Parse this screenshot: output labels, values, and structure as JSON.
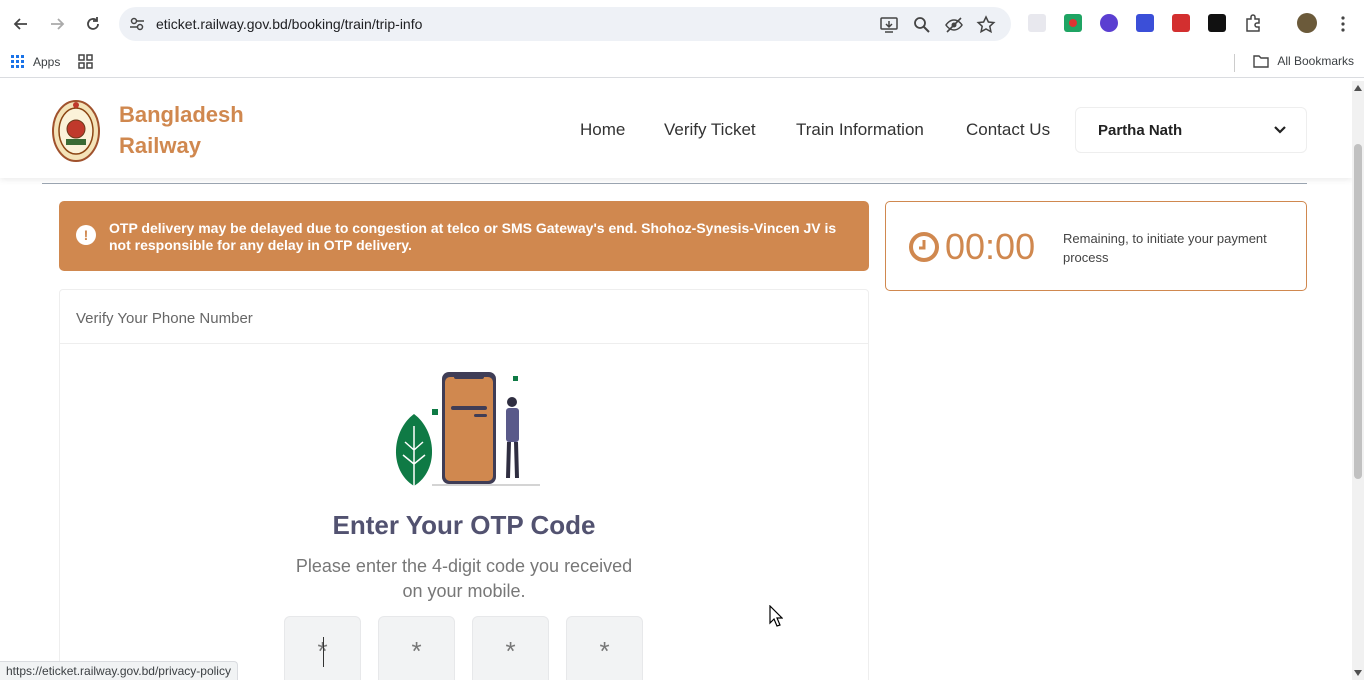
{
  "browser": {
    "url": "eticket.railway.gov.bd/booking/train/trip-info",
    "bookmarks": {
      "apps_label": "Apps",
      "all_bookmarks_label": "All Bookmarks"
    },
    "status_url": "https://eticket.railway.gov.bd/privacy-policy"
  },
  "header": {
    "brand_line1": "Bangladesh",
    "brand_line2": "Railway",
    "menu": [
      "Home",
      "Verify Ticket",
      "Train Information",
      "Contact Us"
    ],
    "user_name": "Partha Nath"
  },
  "alert": {
    "text": "OTP delivery may be delayed due to congestion at telco or SMS Gateway's end. Shohoz-Synesis-Vincen JV is not responsible for any delay in OTP delivery."
  },
  "timer": {
    "time": "00:00",
    "label": "Remaining, to initiate your payment process"
  },
  "verify": {
    "heading": "Verify Your Phone Number",
    "title": "Enter Your OTP Code",
    "subtitle": "Please enter the 4-digit code you received on your mobile.",
    "placeholders": [
      "*",
      "*",
      "*",
      "*"
    ]
  },
  "colors": {
    "brand": "#d0884f",
    "leaf": "#0f7a45",
    "title": "#525270"
  }
}
